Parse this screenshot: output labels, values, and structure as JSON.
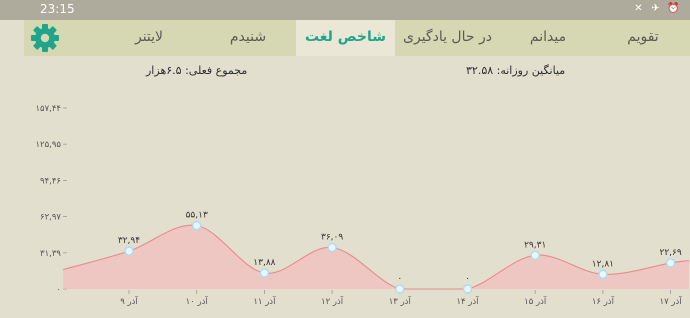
{
  "status": {
    "time": "23:15",
    "icons": [
      "mute-icon",
      "airplane-icon",
      "alarm-icon"
    ]
  },
  "tabs": [
    {
      "label": "تقویم",
      "active": false
    },
    {
      "label": "میدانم",
      "active": false
    },
    {
      "label": "در حال یادگیری",
      "active": false
    },
    {
      "label": "شاخص لغت",
      "active": true
    },
    {
      "label": "شنیدم",
      "active": false
    },
    {
      "label": "لایتنر",
      "active": false
    }
  ],
  "settings_icon": "gear-icon",
  "info": {
    "daily_average": "میانگین روزانه: ۳۲.۵۸",
    "current_total": "مجموع فعلی: ۶.۵هزار"
  },
  "colors": {
    "accent": "#21a48c",
    "line": "#e88a8f",
    "fill": "#f2bcbc",
    "point": "#a9ddf4",
    "tab_bg": "#d6d8b3",
    "bg": "#e3dfcf"
  },
  "chart_data": {
    "type": "area",
    "title": "",
    "xlabel": "",
    "ylabel": "",
    "y_ticks": [
      "۰",
      "۳۱,۳۹",
      "۶۲,۹۷",
      "۹۴,۴۶",
      "۱۲۵,۹۵",
      "۱۵۷,۴۴"
    ],
    "ylim": [
      0,
      157.44
    ],
    "categories": [
      "۹ آذر",
      "۱۰ آذر",
      "۱۱ آذر",
      "۱۲ آذر",
      "۱۳ آذر",
      "۱۴ آذر",
      "۱۵ آذر",
      "۱۶ آذر",
      "۱۷ آذر"
    ],
    "series": [
      {
        "values": [
          32.94,
          55.13,
          13.88,
          36.09,
          0,
          0,
          29.31,
          12.81,
          22.69
        ],
        "labels": [
          "۳۲,۹۴",
          "۵۵,۱۳",
          "۱۳,۸۸",
          "۳۶,۰۹",
          "۰",
          "۰",
          "۲۹,۳۱",
          "۱۲,۸۱",
          "۲۲,۶۹"
        ]
      }
    ],
    "grid": false
  }
}
